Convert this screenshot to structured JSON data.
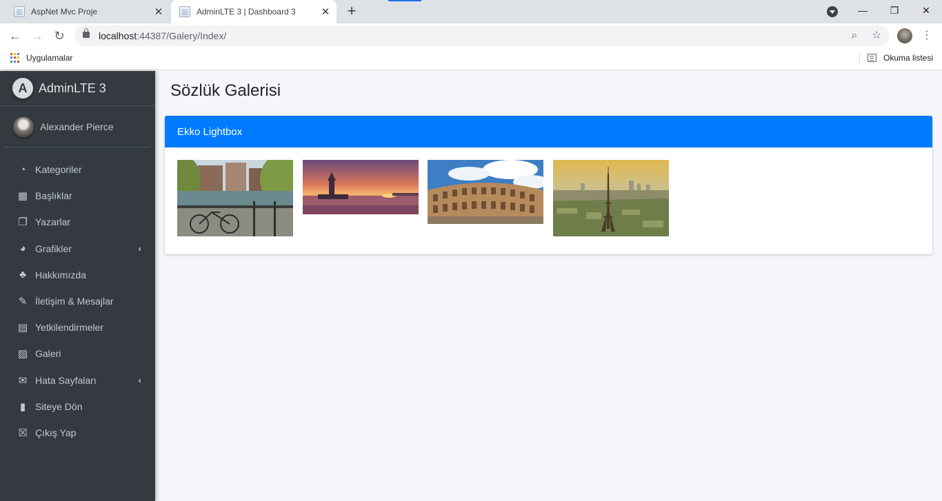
{
  "browser": {
    "tabs": [
      {
        "title": "AspNet Mvc Proje",
        "active": false
      },
      {
        "title": "AdminLTE 3 | Dashboard 3",
        "active": true
      }
    ],
    "new_tab": "+",
    "url_host": "localhost",
    "url_rest": ":44387/Galery/Index/",
    "bookmarks": {
      "apps_label": "Uygulamalar",
      "reading_list_label": "Okuma listesi"
    },
    "window_controls": {
      "minimize": "—",
      "restore": "❐",
      "close": "✕"
    }
  },
  "sidebar": {
    "brand": "AdminLTE 3",
    "brand_logo_letter": "A",
    "user_name": "Alexander Pierce",
    "items": [
      {
        "label": "Kategoriler",
        "icon": "tachometer-icon",
        "glyph": "◔",
        "has_caret": false
      },
      {
        "label": "Başlıklar",
        "icon": "grid-icon",
        "glyph": "▦",
        "has_caret": false
      },
      {
        "label": "Yazarlar",
        "icon": "copy-icon",
        "glyph": "❐",
        "has_caret": false
      },
      {
        "label": "Grafikler",
        "icon": "pie-chart-icon",
        "glyph": "◕",
        "has_caret": true
      },
      {
        "label": "Hakkımızda",
        "icon": "tree-icon",
        "glyph": "♣",
        "has_caret": false
      },
      {
        "label": "İletişim & Mesajlar",
        "icon": "edit-icon",
        "glyph": "✎",
        "has_caret": false
      },
      {
        "label": "Yetkilendirmeler",
        "icon": "calendar-icon",
        "glyph": "▤",
        "has_caret": false
      },
      {
        "label": "Galeri",
        "icon": "image-icon",
        "glyph": "▨",
        "has_caret": false
      },
      {
        "label": "Hata Sayfaları",
        "icon": "envelope-icon",
        "glyph": "✉",
        "has_caret": true
      },
      {
        "label": "Siteye Dön",
        "icon": "book-icon",
        "glyph": "▮",
        "has_caret": false
      },
      {
        "label": "Çıkış Yap",
        "icon": "close-square-icon",
        "glyph": "☒",
        "has_caret": false
      }
    ],
    "caret": "‹"
  },
  "content": {
    "title": "Sözlük Galerisi",
    "card_title": "Ekko Lightbox",
    "images": [
      {
        "subject": "amsterdam-canal-bicycle"
      },
      {
        "subject": "maiden-tower-sunset"
      },
      {
        "subject": "colosseum-rome"
      },
      {
        "subject": "eiffel-tower-paris"
      }
    ]
  },
  "colors": {
    "sidebar_bg": "#343a40",
    "content_bg": "#f4f6f9",
    "primary": "#007bff",
    "sidebar_text": "#c2c7d0"
  }
}
